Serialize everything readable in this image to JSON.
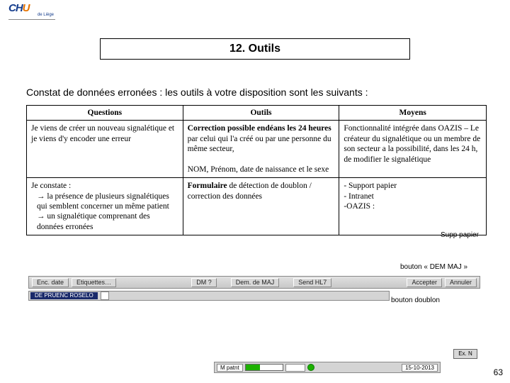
{
  "logo": {
    "text1": "CH",
    "text2": "U",
    "sub": "de Liège"
  },
  "title": "12. Outils",
  "subtitle": "Constat de données erronées : les outils à votre disposition sont les suivants :",
  "table": {
    "headers": {
      "q": "Questions",
      "o": "Outils",
      "m": "Moyens"
    },
    "row1": {
      "q": "Je viens de créer un nouveau signalétique et je viens d'y encoder une erreur",
      "o1": "Correction possible endéans les 24 heures",
      "o1b": " par celui qui l'a créé ou par une personne du même secteur,",
      "o2": " NOM, Prénom, date de naissance et le sexe",
      "m": "Fonctionnalité intégrée dans OAZIS – Le créateur du signalétique ou un membre de son secteur a la possibilité, dans les 24 h, de modifier le signalétique"
    },
    "row2": {
      "q_l1": "Je constate :",
      "q_l2": "→ la présence de plusieurs signalétiques qui semblent concerner un même patient",
      "q_l3": "→ un signalétique comprenant des données erronées",
      "o1": "Formulaire",
      "o1b": " de détection de doublon / correction des données",
      "m1": "- Support papier",
      "m2": "- Intranet",
      "m3": "-OAZIS :"
    }
  },
  "labels": {
    "supp_papier": "Supp papier",
    "btn_dem_maj": "bouton « DEM MAJ »",
    "btn_doublon": "bouton doublon"
  },
  "uibar1": {
    "b1": "Enc. date",
    "b2": "Etiquettes…",
    "b3": "DM ?",
    "b4": "Dem. de MAJ",
    "b5": "Send HL7",
    "b6": "Accepter",
    "b7": "Annuler"
  },
  "uibar2": {
    "chip": "DE PRUENC ROSELO"
  },
  "uibar3": {
    "f1": "M patnt",
    "f2": "",
    "f3": "15-10-2013"
  },
  "ex_btn": "Ex. N",
  "page": "63"
}
